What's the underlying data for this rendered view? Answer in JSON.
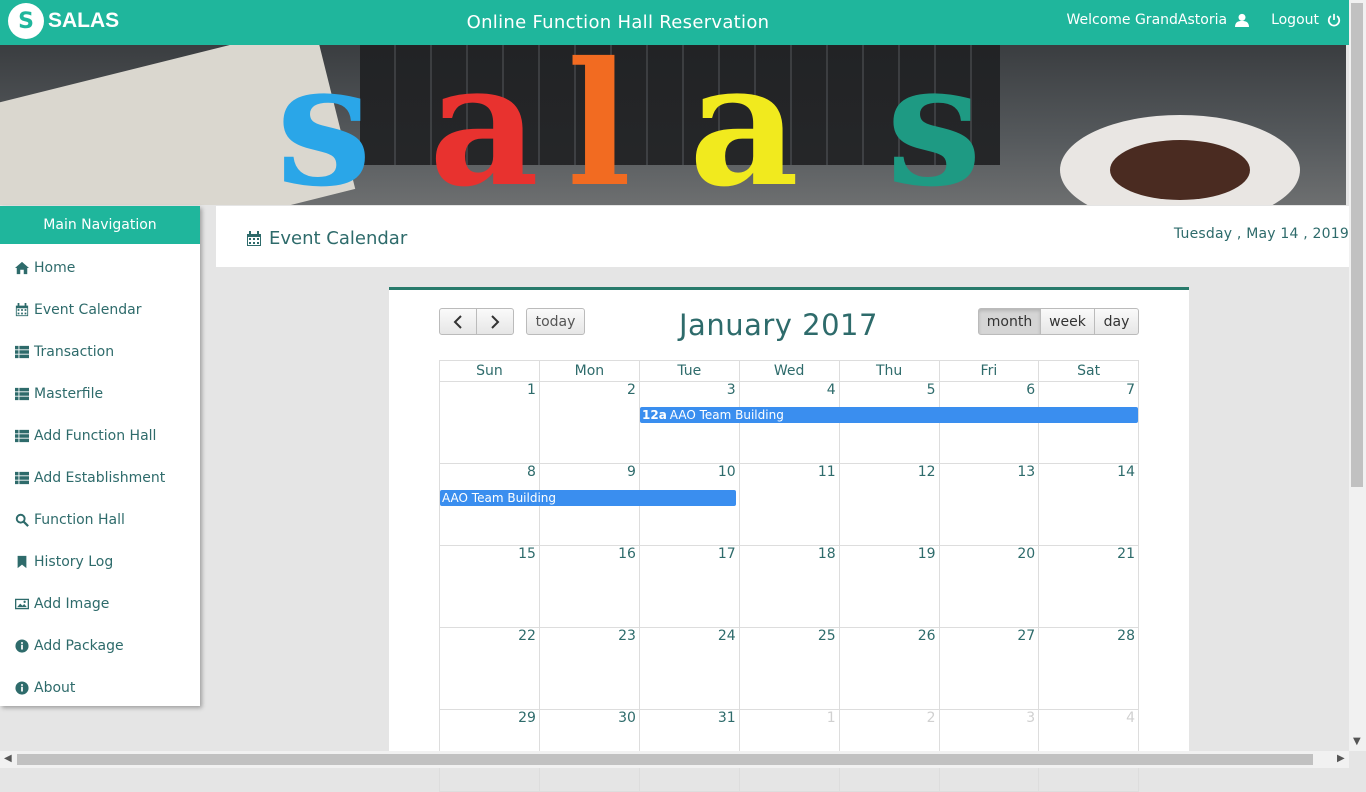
{
  "header": {
    "brand": "SALAS",
    "title": "Online Function Hall Reservation",
    "welcome": "Welcome GrandAstoria",
    "logout": "Logout"
  },
  "banner": {
    "letters": [
      "s",
      "a",
      "l",
      "a",
      "s"
    ],
    "colors": [
      "#2aa6e8",
      "#e8322f",
      "#f26b21",
      "#f1ea1e",
      "#1e9a83"
    ]
  },
  "sidebar": {
    "title": "Main Navigation",
    "items": [
      {
        "label": "Home",
        "icon": "home-icon"
      },
      {
        "label": "Event Calendar",
        "icon": "calendar-icon"
      },
      {
        "label": "Transaction",
        "icon": "list-icon"
      },
      {
        "label": "Masterfile",
        "icon": "list-icon"
      },
      {
        "label": "Add Function Hall",
        "icon": "list-icon"
      },
      {
        "label": "Add Establishment",
        "icon": "list-icon"
      },
      {
        "label": "Function Hall",
        "icon": "search-icon"
      },
      {
        "label": "History Log",
        "icon": "bookmark-icon"
      },
      {
        "label": "Add Image",
        "icon": "image-icon"
      },
      {
        "label": "Add Package",
        "icon": "info-icon"
      },
      {
        "label": "About",
        "icon": "info-icon"
      }
    ]
  },
  "content": {
    "title": "Event Calendar",
    "date": "Tuesday , May 14 , 2019"
  },
  "calendar": {
    "title": "January 2017",
    "today_label": "today",
    "views": [
      "month",
      "week",
      "day"
    ],
    "active_view": "month",
    "weekdays": [
      "Sun",
      "Mon",
      "Tue",
      "Wed",
      "Thu",
      "Fri",
      "Sat"
    ],
    "weeks": [
      [
        "1",
        "2",
        "3",
        "4",
        "5",
        "6",
        "7"
      ],
      [
        "8",
        "9",
        "10",
        "11",
        "12",
        "13",
        "14"
      ],
      [
        "15",
        "16",
        "17",
        "18",
        "19",
        "20",
        "21"
      ],
      [
        "22",
        "23",
        "24",
        "25",
        "26",
        "27",
        "28"
      ],
      [
        "29",
        "30",
        "31",
        "1",
        "2",
        "3",
        "4"
      ]
    ],
    "events": [
      {
        "time": "12a",
        "title": "AAO Team Building"
      },
      {
        "time": "",
        "title": "AAO Team Building"
      }
    ]
  },
  "colors": {
    "accent": "#1fb69c",
    "text": "#2e6b6b",
    "event": "#3a8eef"
  }
}
